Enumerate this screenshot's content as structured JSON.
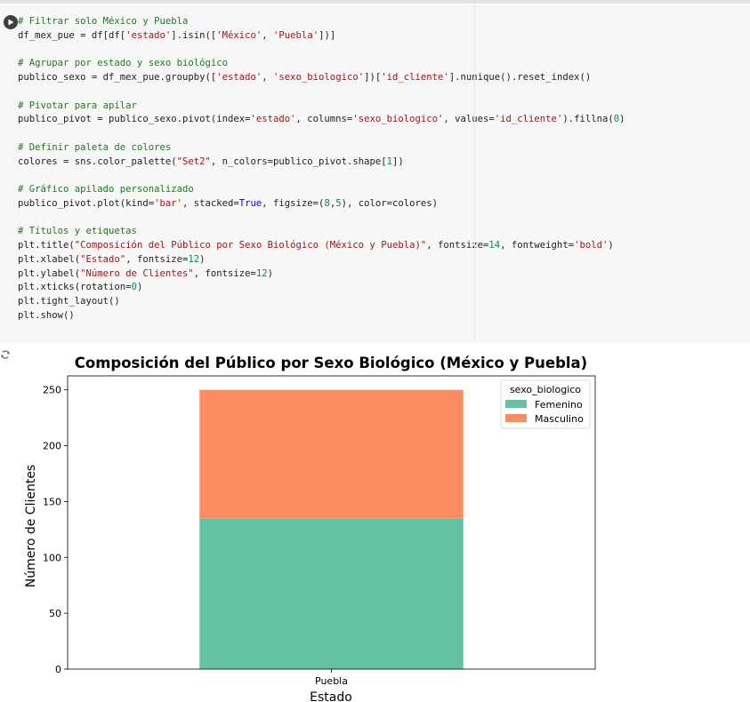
{
  "cell": {
    "code_lines": [
      [
        {
          "t": "# Filtrar solo México y Puebla",
          "c": "comment"
        }
      ],
      [
        {
          "t": "df_mex_pue = df[df["
        },
        {
          "t": "'estado'",
          "c": "string"
        },
        {
          "t": "].isin(["
        },
        {
          "t": "'México'",
          "c": "string"
        },
        {
          "t": ", "
        },
        {
          "t": "'Puebla'",
          "c": "string"
        },
        {
          "t": "])]"
        }
      ],
      [
        {
          "t": ""
        }
      ],
      [
        {
          "t": "# Agrupar por estado y sexo biológico",
          "c": "comment"
        }
      ],
      [
        {
          "t": "publico_sexo = df_mex_pue.groupby(["
        },
        {
          "t": "'estado'",
          "c": "string"
        },
        {
          "t": ", "
        },
        {
          "t": "'sexo_biologico'",
          "c": "string"
        },
        {
          "t": "])["
        },
        {
          "t": "'id_cliente'",
          "c": "string"
        },
        {
          "t": "].nunique().reset_index()"
        }
      ],
      [
        {
          "t": ""
        }
      ],
      [
        {
          "t": "# Pivotar para apilar",
          "c": "comment"
        }
      ],
      [
        {
          "t": "publico_pivot = publico_sexo.pivot(index="
        },
        {
          "t": "'estado'",
          "c": "string"
        },
        {
          "t": ", columns="
        },
        {
          "t": "'sexo_biologico'",
          "c": "string"
        },
        {
          "t": ", values="
        },
        {
          "t": "'id_cliente'",
          "c": "string"
        },
        {
          "t": ").fillna("
        },
        {
          "t": "0",
          "c": "number"
        },
        {
          "t": ")"
        }
      ],
      [
        {
          "t": ""
        }
      ],
      [
        {
          "t": "# Definir paleta de colores",
          "c": "comment"
        }
      ],
      [
        {
          "t": "colores = sns.color_palette("
        },
        {
          "t": "\"Set2\"",
          "c": "string"
        },
        {
          "t": ", n_colors=publico_pivot.shape["
        },
        {
          "t": "1",
          "c": "number"
        },
        {
          "t": "])"
        }
      ],
      [
        {
          "t": ""
        }
      ],
      [
        {
          "t": "# Gráfico apilado personalizado",
          "c": "comment"
        }
      ],
      [
        {
          "t": "publico_pivot.plot(kind="
        },
        {
          "t": "'bar'",
          "c": "string"
        },
        {
          "t": ", stacked="
        },
        {
          "t": "True",
          "c": "kw"
        },
        {
          "t": ", figsize=("
        },
        {
          "t": "8",
          "c": "number"
        },
        {
          "t": ","
        },
        {
          "t": "5",
          "c": "number"
        },
        {
          "t": "), color=colores)"
        }
      ],
      [
        {
          "t": ""
        }
      ],
      [
        {
          "t": "# Títulos y etiquetas",
          "c": "comment"
        }
      ],
      [
        {
          "t": "plt.title("
        },
        {
          "t": "\"Composición del Público por Sexo Biológico (México y Puebla)\"",
          "c": "string"
        },
        {
          "t": ", fontsize="
        },
        {
          "t": "14",
          "c": "number"
        },
        {
          "t": ", fontweight="
        },
        {
          "t": "'bold'",
          "c": "string"
        },
        {
          "t": ")"
        }
      ],
      [
        {
          "t": "plt.xlabel("
        },
        {
          "t": "\"Estado\"",
          "c": "string"
        },
        {
          "t": ", fontsize="
        },
        {
          "t": "12",
          "c": "number"
        },
        {
          "t": ")"
        }
      ],
      [
        {
          "t": "plt.ylabel("
        },
        {
          "t": "\"Número de Clientes\"",
          "c": "string"
        },
        {
          "t": ", fontsize="
        },
        {
          "t": "12",
          "c": "number"
        },
        {
          "t": ")"
        }
      ],
      [
        {
          "t": "plt.xticks(rotation="
        },
        {
          "t": "0",
          "c": "number"
        },
        {
          "t": ")"
        }
      ],
      [
        {
          "t": "plt.tight_layout()"
        }
      ],
      [
        {
          "t": "plt.show()"
        }
      ]
    ]
  },
  "colors": {
    "femenino": "#66c2a5",
    "masculino": "#fc8d62",
    "comment": "#1f7a1f",
    "string": "#a31515",
    "number": "#098658"
  },
  "chart_data": {
    "type": "bar",
    "stacked": true,
    "title": "Composición del Público por Sexo Biológico (México y Puebla)",
    "xlabel": "Estado",
    "ylabel": "Número de Clientes",
    "categories": [
      "Puebla"
    ],
    "series": [
      {
        "name": "Femenino",
        "values": [
          135
        ]
      },
      {
        "name": "Masculino",
        "values": [
          115
        ]
      }
    ],
    "ylim": [
      0,
      262.5
    ],
    "yticks": [
      0,
      50,
      100,
      150,
      200,
      250
    ],
    "legend_title": "sexo_biologico",
    "legend_position": "top-right",
    "grid": false
  }
}
